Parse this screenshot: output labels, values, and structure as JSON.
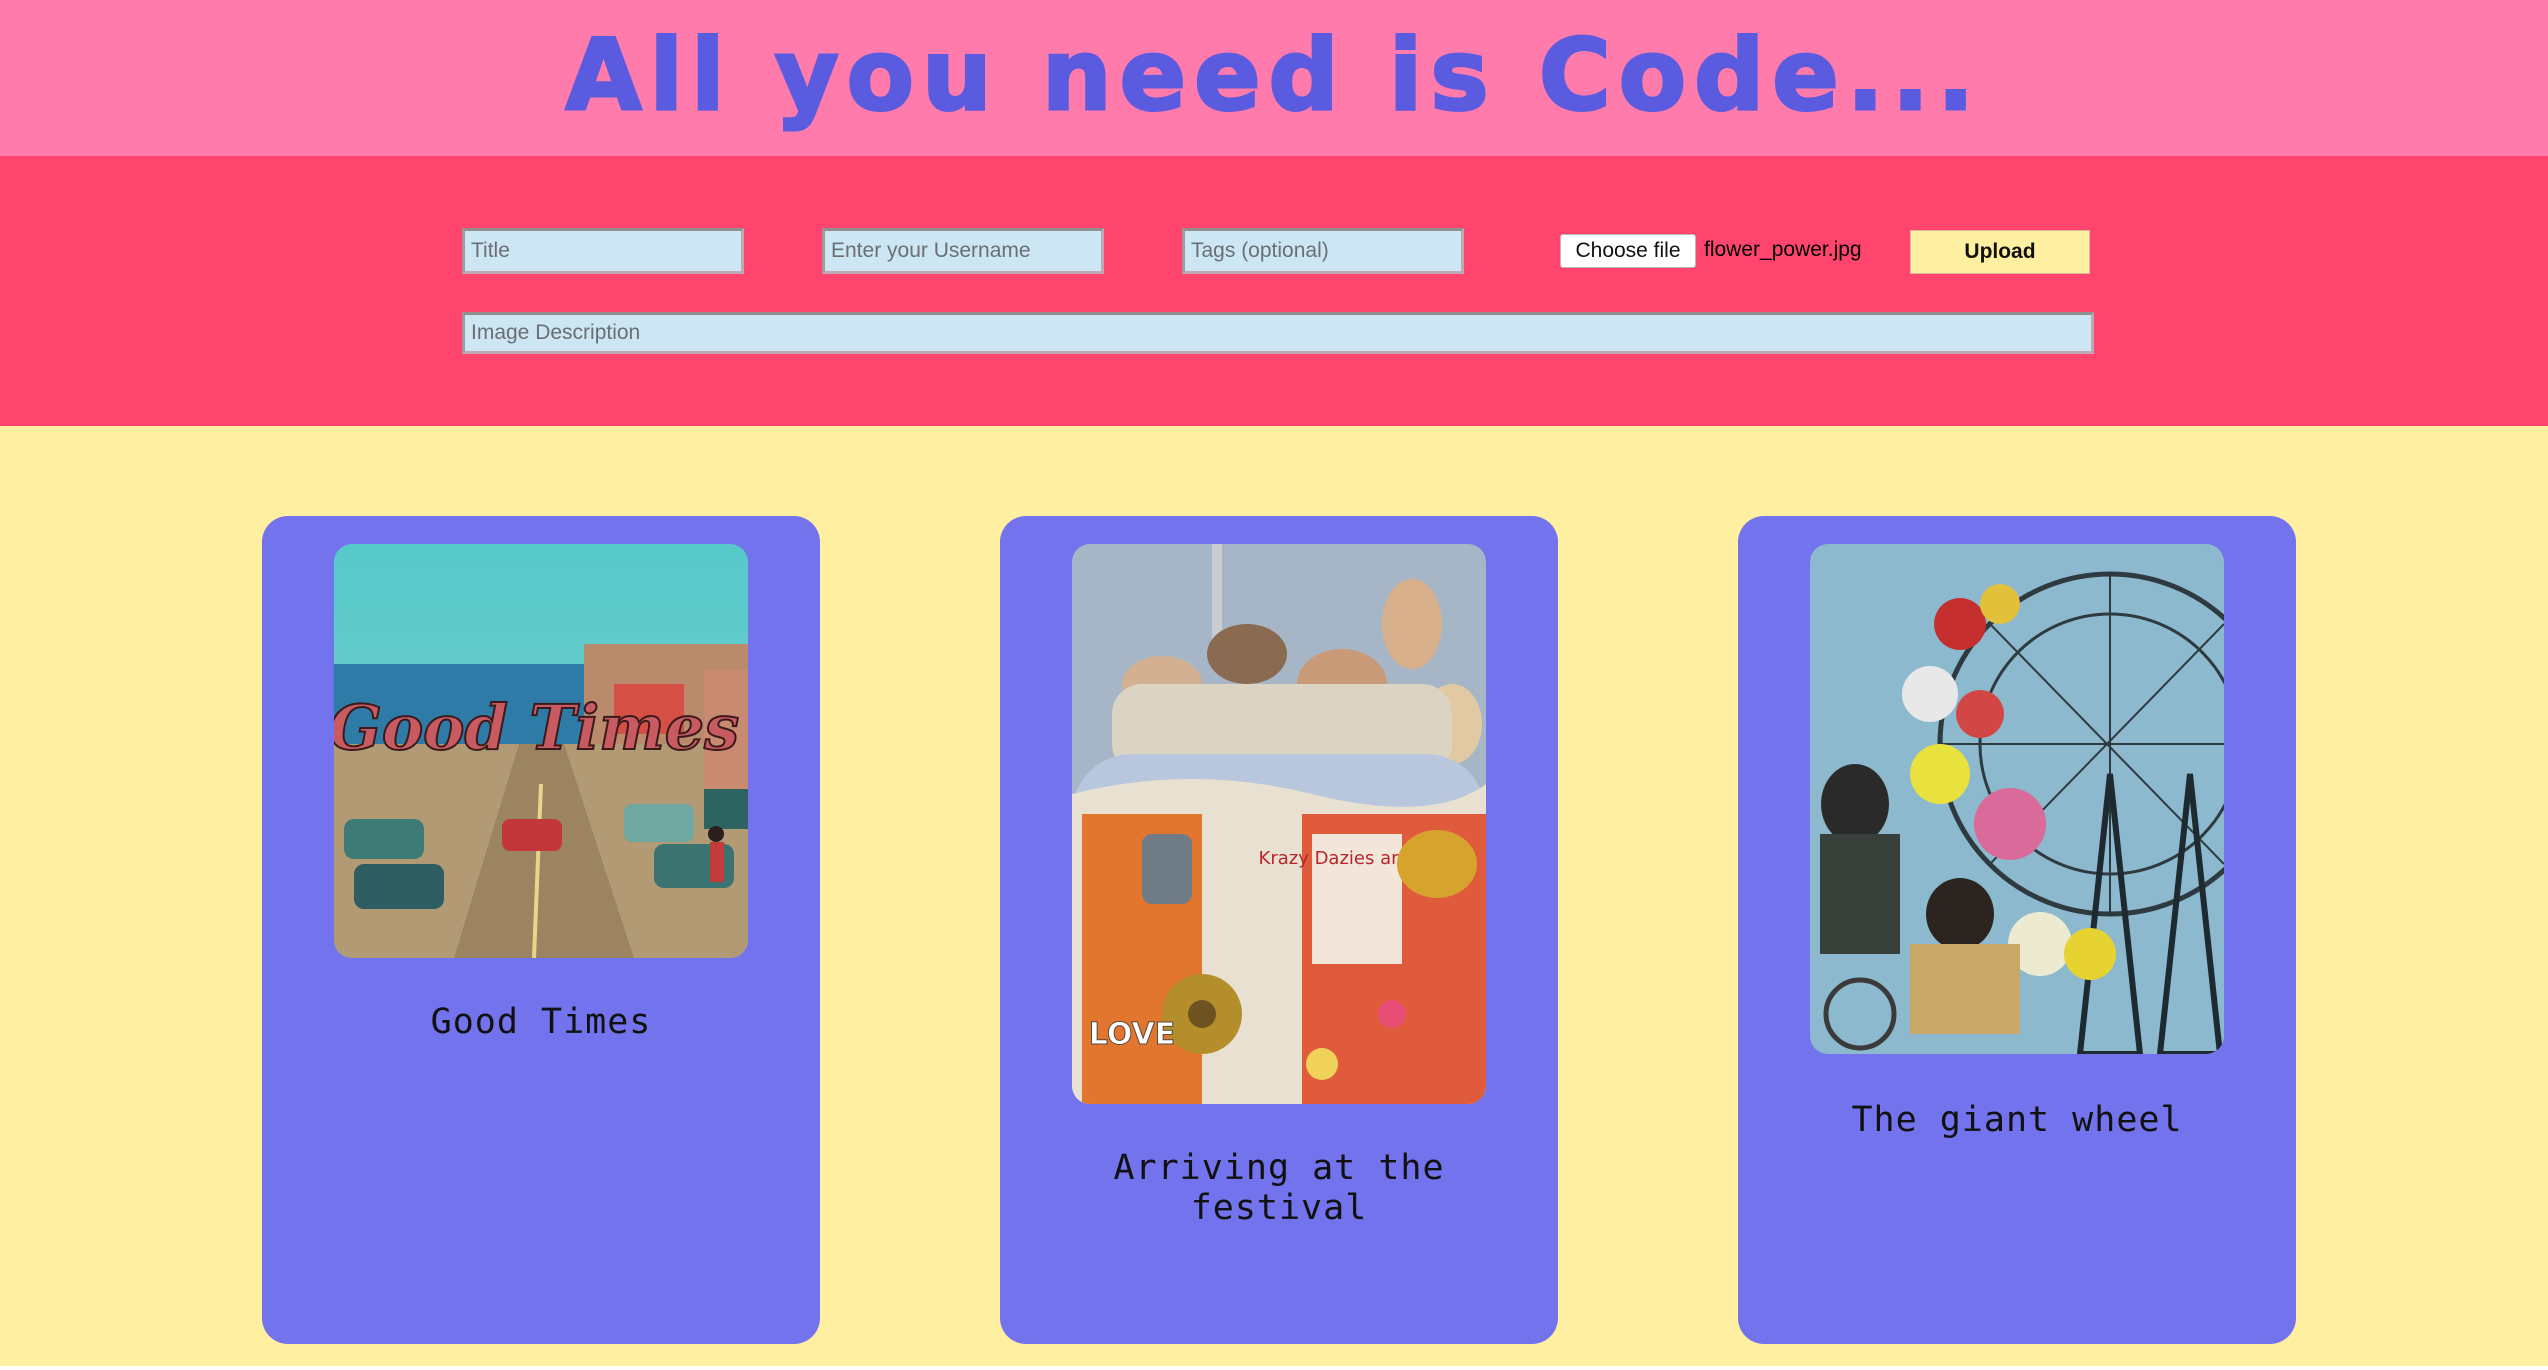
{
  "header": {
    "title": "All you need is Code..."
  },
  "form": {
    "title_placeholder": "Title",
    "username_placeholder": "Enter your Username",
    "tags_placeholder": "Tags (optional)",
    "choose_file_label": "Choose file",
    "file_name": "flower_power.jpg",
    "upload_label": "Upload",
    "description_placeholder": "Image Description"
  },
  "cards": [
    {
      "title": "Good Times",
      "image_text": "Good Times"
    },
    {
      "title": "Arriving at the festival",
      "image_text": "Krazy Dazies are here",
      "badge_text": "LOVE"
    },
    {
      "title": "The giant wheel"
    }
  ],
  "colors": {
    "header_bg": "#FF7BAC",
    "form_bg": "#FF456E",
    "page_bg": "#FFEFA0",
    "card_bg": "#7373ED",
    "title_color": "#5B5BE0"
  }
}
